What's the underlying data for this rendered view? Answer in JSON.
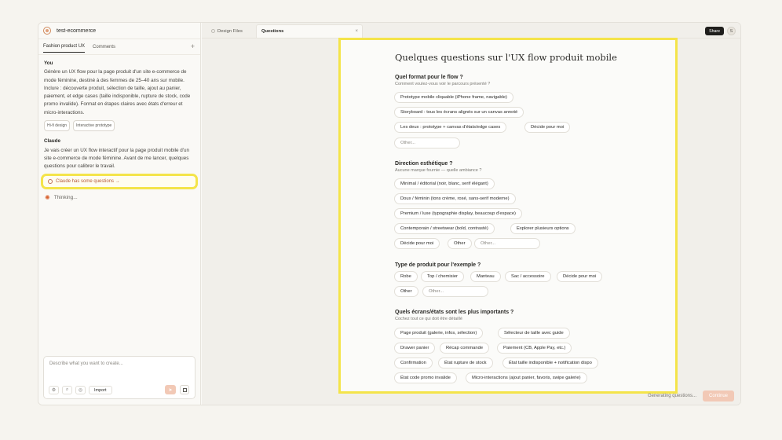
{
  "project": {
    "name": "test-ecommerce"
  },
  "left_tabs": [
    "Fashion product UX",
    "Comments"
  ],
  "messages": {
    "user_label": "You",
    "user_text": "Génère un UX flow pour la page produit d'un site e-commerce de mode féminine, destiné à des femmes de 25–40 ans sur mobile. Inclure : découverte produit, sélection de taille, ajout au panier, paiement, et edge cases (taille indisponible, rupture de stock, code promo invalide). Format en étapes claires avec états d'erreur et micro-interactions.",
    "chips": [
      "Hi-fi design",
      "Interactive prototype"
    ],
    "claude_label": "Claude",
    "claude_text": "Je vais créer un UX flow interactif pour la page produit mobile d'un site e-commerce de mode féminine. Avant de me lancer, quelques questions pour calibrer le travail.",
    "questions_link": "Claude has some questions →",
    "thinking": "Thinking..."
  },
  "composer": {
    "placeholder": "Describe what you want to create...",
    "import_label": "Import"
  },
  "tabs": [
    {
      "label": "Design Files"
    },
    {
      "label": "Questions",
      "close": "×"
    }
  ],
  "header": {
    "share": "Share",
    "avatar": "S"
  },
  "form": {
    "title": "Quelques questions sur l'UX flow produit mobile",
    "q1": {
      "title": "Quel format pour le flow ?",
      "sub": "Comment voulez-vous voir le parcours présenté ?",
      "options": [
        "Prototype mobile cliquable (iPhone frame, navigable)",
        "Storyboard : tous les écrans alignés sur un canvas annoté",
        "Les deux : prototype + canvas d'états/edge cases",
        "Décide pour moi"
      ],
      "other": "Other..."
    },
    "q2": {
      "title": "Direction esthétique ?",
      "sub": "Aucune marque fournie — quelle ambiance ?",
      "options": [
        "Minimal / éditorial (noir, blanc, serif élégant)",
        "Doux / féminin (tons crème, rosé, sans-serif moderne)",
        "Premium / luxe (typographie display, beaucoup d'espace)",
        "Contemporain / streetwear (bold, contrasté)",
        "Explorer plusieurs options",
        "Décide pour moi",
        "Other"
      ],
      "other": "Other..."
    },
    "q3": {
      "title": "Type de produit pour l'exemple ?",
      "options": [
        "Robe",
        "Top / chemisier",
        "Manteau",
        "Sac / accessoire",
        "Décide pour moi",
        "Other"
      ],
      "other": "Other..."
    },
    "q4": {
      "title": "Quels écrans/états sont les plus importants ?",
      "sub": "Cochez tout ce qui doit être détaillé",
      "options": [
        "Page produit (galerie, infos, sélection)",
        "Sélecteur de taille avec guide",
        "Drawer panier",
        "Récap commande",
        "Paiement (CB, Apple Pay, etc.)",
        "Confirmation",
        "État rupture de stock",
        "État taille indisponible + notification dispo",
        "État code promo invalide",
        "Micro-interactions (ajout panier, favoris, swipe galerie)"
      ]
    }
  },
  "footer": {
    "status": "Generating questions...",
    "continue": "Continue"
  },
  "colors": {
    "highlight": "#f4e44a",
    "accent": "#b65a3a",
    "continue_bg": "#f2c9b6"
  }
}
